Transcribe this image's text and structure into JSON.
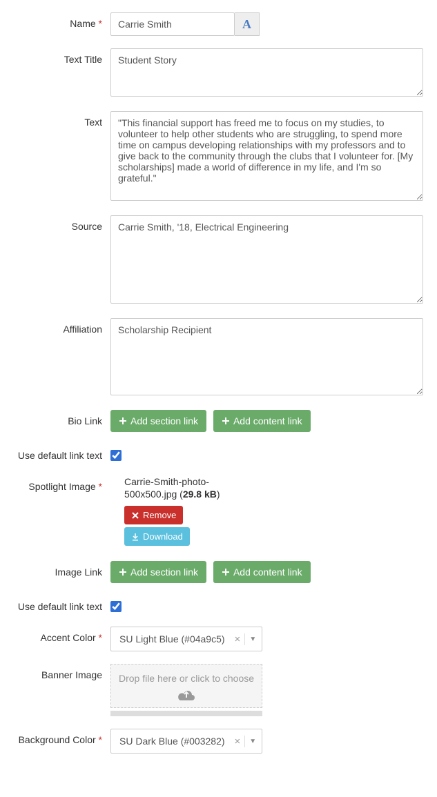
{
  "labels": {
    "name": "Name",
    "text_title": "Text Title",
    "text": "Text",
    "source": "Source",
    "affiliation": "Affiliation",
    "bio_link": "Bio Link",
    "use_default_link_text": "Use default link text",
    "spotlight_image": "Spotlight Image",
    "image_link": "Image Link",
    "accent_color": "Accent Color",
    "banner_image": "Banner Image",
    "background_color": "Background Color"
  },
  "values": {
    "name": "Carrie Smith",
    "text_title": "Student Story",
    "text": "\"This financial support has freed me to focus on my studies, to volunteer to help other students who are struggling, to spend more time on campus developing relationships with my professors and to give back to the community through the clubs that I volunteer for. [My scholarships] made a world of difference in my life, and I'm so grateful.\"",
    "source": "Carrie Smith, '18, Electrical Engineering",
    "affiliation": "Scholarship Recipient",
    "use_default_link_text_bio": true,
    "use_default_link_text_image": true,
    "accent_color": "SU Light Blue (#04a9c5)",
    "background_color": "SU Dark Blue (#003282)"
  },
  "buttons": {
    "add_section_link": "Add section link",
    "add_content_link": "Add content link",
    "remove": "Remove",
    "download": "Download"
  },
  "spotlight_file": {
    "name_part1": "Carrie-Smith-photo-500x500.jpg",
    "size": "29.8 kB"
  },
  "dropzone": {
    "text": "Drop file here or click to choose"
  }
}
